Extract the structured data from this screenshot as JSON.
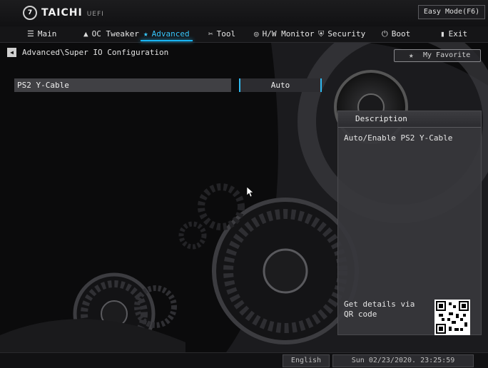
{
  "header": {
    "brand": "TAICHI",
    "brand_sub": "UEFI",
    "easy_mode_label": "Easy Mode(F6)"
  },
  "nav": {
    "items": [
      {
        "label": "Main",
        "icon": "list-icon"
      },
      {
        "label": "OC Tweaker",
        "icon": "rocket-icon"
      },
      {
        "label": "Advanced",
        "icon": "star-icon",
        "active": true
      },
      {
        "label": "Tool",
        "icon": "tool-icon"
      },
      {
        "label": "H/W Monitor",
        "icon": "monitor-icon"
      },
      {
        "label": "Security",
        "icon": "shield-icon"
      },
      {
        "label": "Boot",
        "icon": "power-icon"
      },
      {
        "label": "Exit",
        "icon": "exit-icon"
      }
    ]
  },
  "breadcrumb": {
    "path": "Advanced\\Super IO Configuration"
  },
  "favorite": {
    "label": "My Favorite"
  },
  "settings": {
    "rows": [
      {
        "label": "PS2 Y-Cable",
        "value": "Auto"
      }
    ]
  },
  "description": {
    "title": "Description",
    "text": "Auto/Enable PS2 Y-Cable",
    "qr_label": "Get details via QR code"
  },
  "footer": {
    "language": "English",
    "datetime": "Sun 02/23/2020. 23:25:59"
  },
  "colors": {
    "accent": "#19b6f5",
    "background": "#0b0b0c",
    "panel": "#37373c"
  }
}
